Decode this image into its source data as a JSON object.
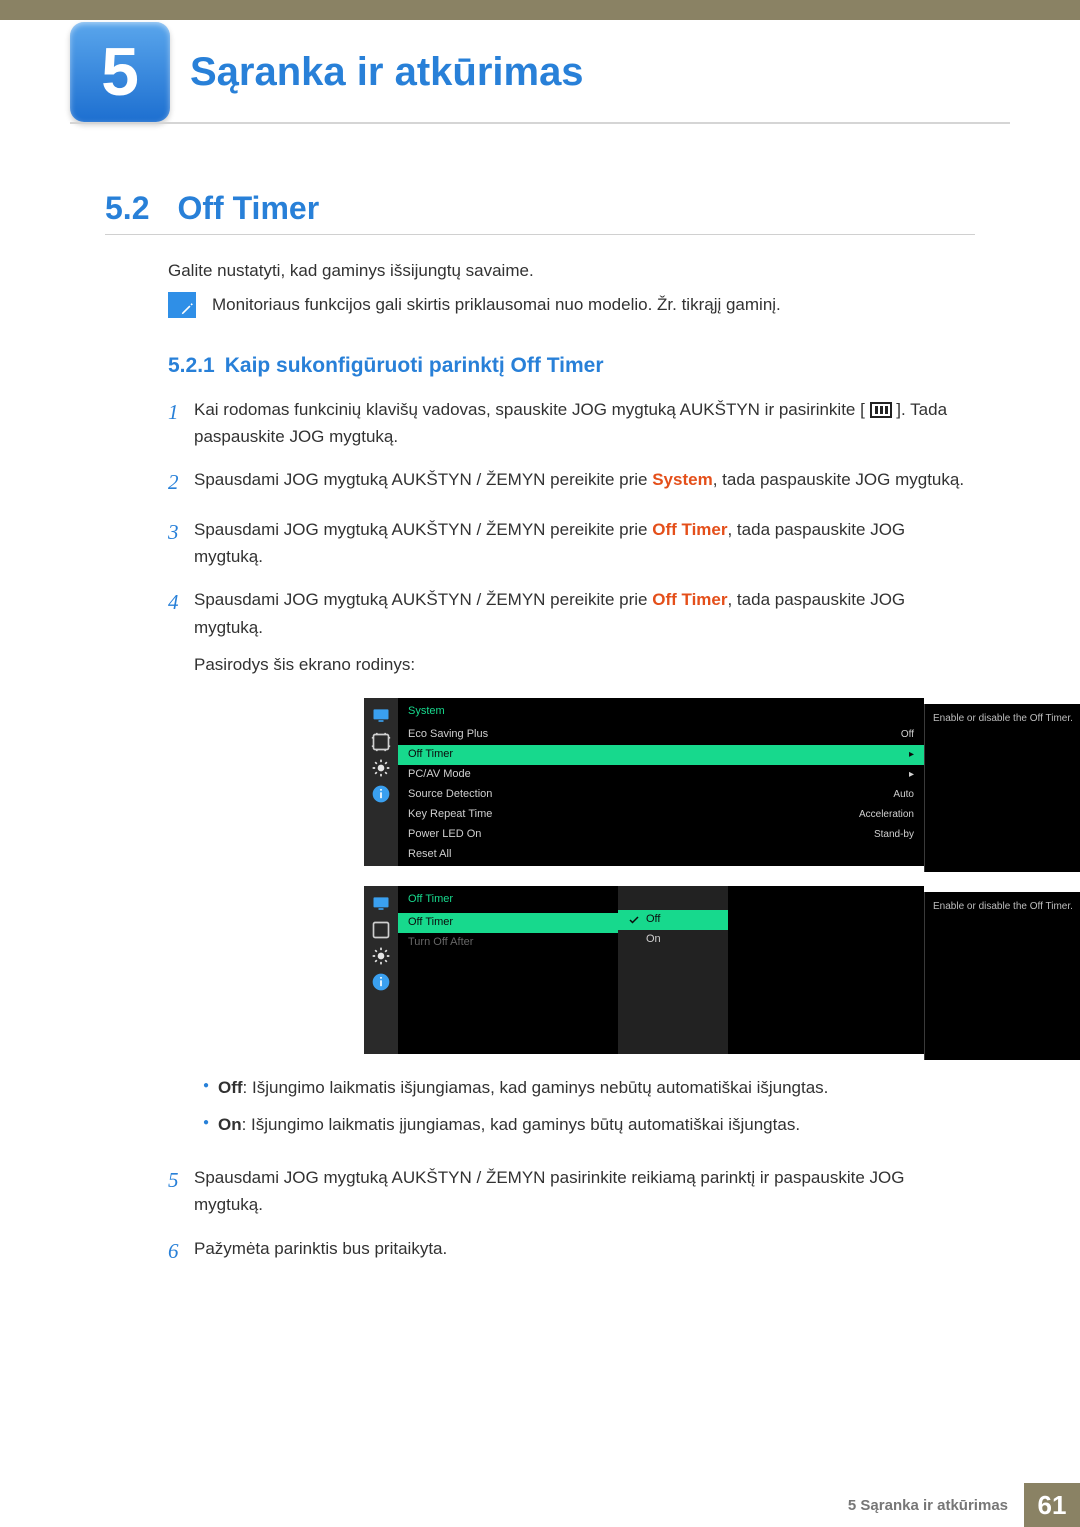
{
  "chapter": {
    "number": "5",
    "title": "Sąranka ir atkūrimas"
  },
  "section": {
    "number": "5.2",
    "title": "Off Timer"
  },
  "intro": "Galite nustatyti, kad gaminys išsijungtų savaime.",
  "note": "Monitoriaus funkcijos gali skirtis priklausomai nuo modelio. Žr. tikrąjį gaminį.",
  "subsection": {
    "number": "5.2.1",
    "title": "Kaip sukonfigūruoti parinktį Off Timer"
  },
  "steps": {
    "s1": {
      "a": "Kai rodomas funkcinių klavišų vadovas, spauskite JOG mygtuką AUKŠTYN ir pasirinkite [",
      "b": "]. Tada paspauskite JOG mygtuką."
    },
    "s2": {
      "a": "Spausdami JOG mygtuką AUKŠTYN / ŽEMYN pereikite prie ",
      "hl": "System",
      "b": ", tada paspauskite JOG mygtuką."
    },
    "s3": {
      "a": "Spausdami JOG mygtuką AUKŠTYN / ŽEMYN pereikite prie ",
      "hl": "Off Timer",
      "b": ", tada paspauskite JOG mygtuką."
    },
    "s4": {
      "a": "Spausdami JOG mygtuką AUKŠTYN / ŽEMYN pereikite prie ",
      "hl": "Off Timer",
      "b": ", tada paspauskite JOG mygtuką."
    },
    "s4_after": "Pasirodys šis ekrano rodinys:",
    "s5": "Spausdami JOG mygtuką AUKŠTYN / ŽEMYN pasirinkite reikiamą parinktį ir paspauskite JOG mygtuką.",
    "s6": "Pažymėta parinktis bus pritaikyta."
  },
  "osd1": {
    "title": "System",
    "rows": [
      {
        "label": "Eco Saving Plus",
        "val": "Off"
      },
      {
        "label": "Off Timer",
        "val": "▸",
        "sel": true
      },
      {
        "label": "PC/AV Mode",
        "val": "▸"
      },
      {
        "label": "Source Detection",
        "val": "Auto"
      },
      {
        "label": "Key Repeat Time",
        "val": "Acceleration"
      },
      {
        "label": "Power LED On",
        "val": "Stand-by"
      },
      {
        "label": "Reset All",
        "val": ""
      }
    ],
    "tip": "Enable or disable the Off Timer."
  },
  "osd2": {
    "title": "Off Timer",
    "rows": [
      {
        "label": "Off Timer",
        "sel": true
      },
      {
        "label": "Turn Off After",
        "disabled": true
      }
    ],
    "options": [
      {
        "label": "Off",
        "sel": true
      },
      {
        "label": "On"
      }
    ],
    "tip": "Enable or disable the Off Timer."
  },
  "bullets": {
    "off": {
      "lbl": "Off",
      "txt": ": Išjungimo laikmatis išjungiamas, kad gaminys nebūtų automatiškai išjungtas."
    },
    "on": {
      "lbl": "On",
      "txt": ": Išjungimo laikmatis įjungiamas, kad gaminys būtų automatiškai išjungtas."
    }
  },
  "footer": {
    "text": "5 Sąranka ir atkūrimas",
    "page": "61"
  }
}
